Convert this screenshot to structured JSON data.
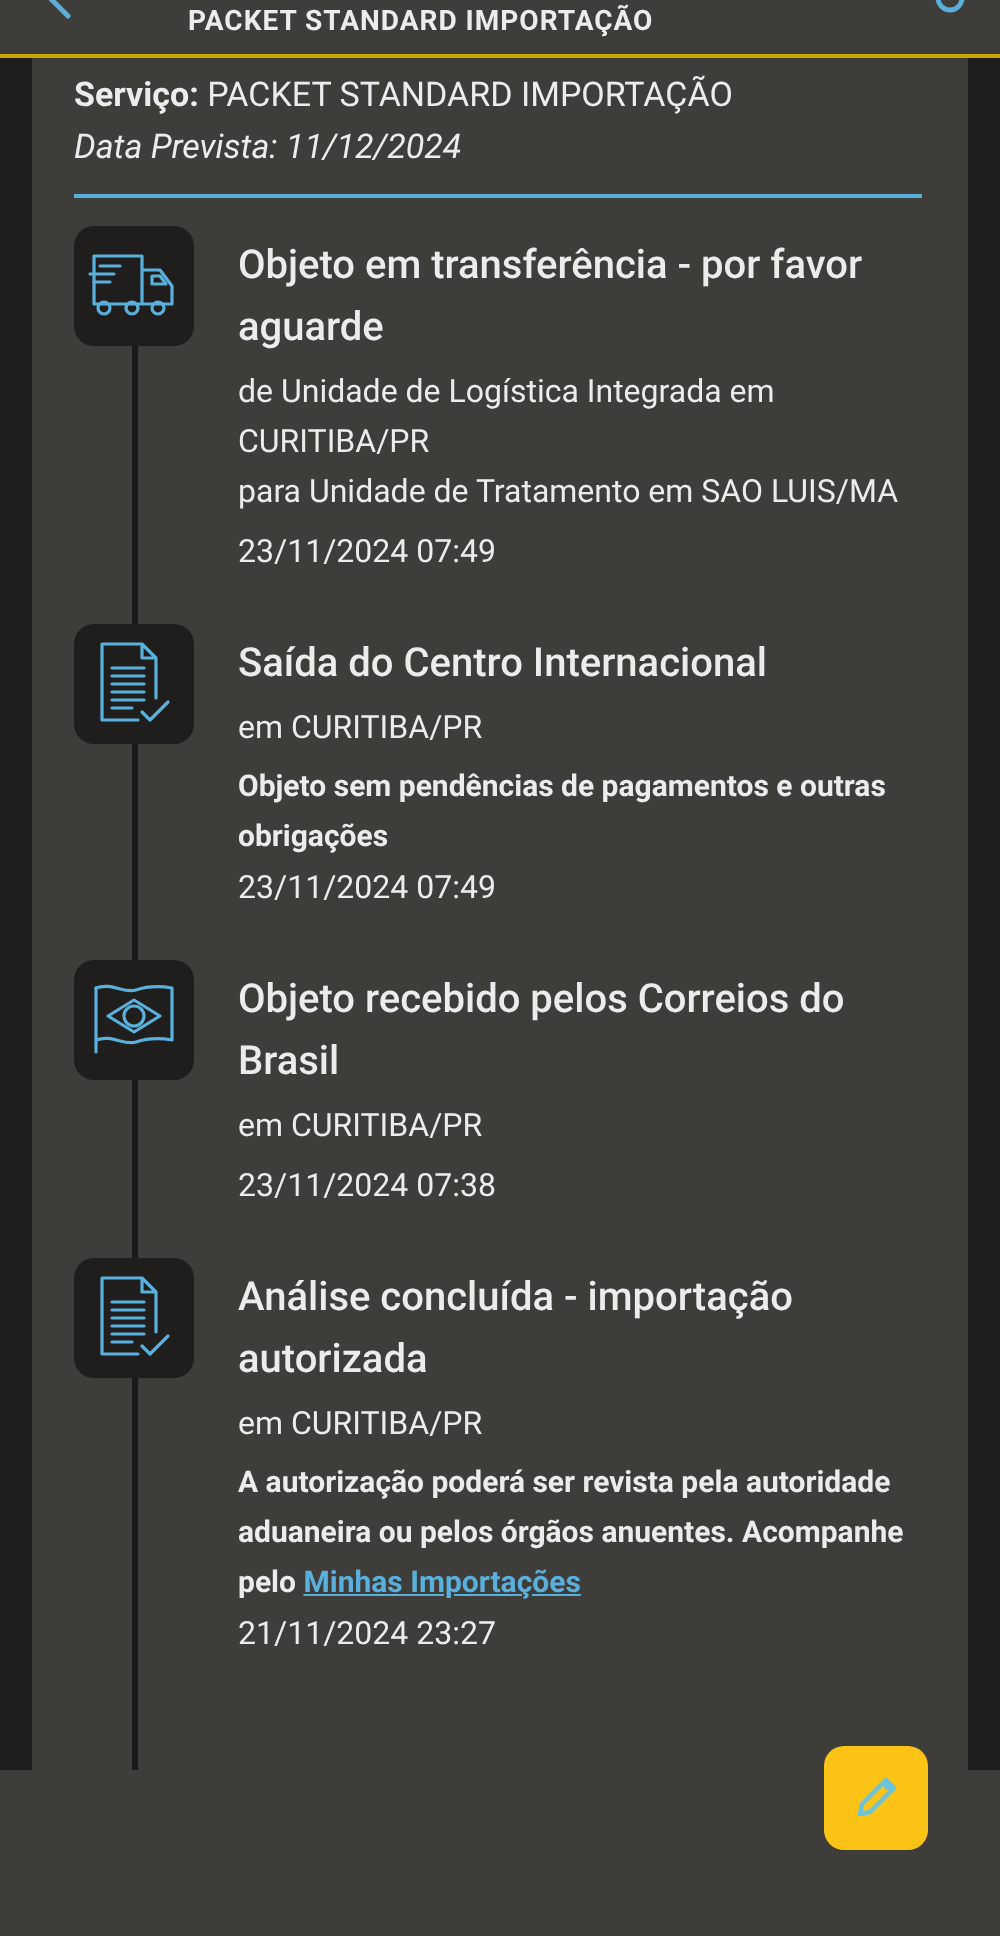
{
  "app_bar": {
    "title": "PACKET STANDARD IMPORTAÇÃO"
  },
  "summary": {
    "service_label": "Serviço:",
    "service": "PACKET STANDARD IMPORTAÇÃO",
    "due_date": "Data Prevista: 11/12/2024"
  },
  "events": [
    {
      "kind": "truck",
      "title": "Objeto em transferência - por favor aguarde",
      "lines": [
        "de Unidade de Logística Integrada em CURITIBA/PR",
        "para Unidade de Tratamento em SAO LUIS/MA"
      ],
      "date": "23/11/2024 07:49"
    },
    {
      "kind": "document",
      "title": "Saída do Centro Internacional",
      "lines": [
        "em CURITIBA/PR"
      ],
      "note": "Objeto sem pendências de pagamentos e outras obrigações",
      "date": "23/11/2024 07:49"
    },
    {
      "kind": "flag",
      "title": "Objeto recebido pelos Correios do Brasil",
      "lines": [
        "em CURITIBA/PR"
      ],
      "date": "23/11/2024 07:38"
    },
    {
      "kind": "document",
      "title": "Análise concluída - importação autorizada",
      "lines": [
        "em CURITIBA/PR"
      ],
      "note": "A autorização poderá ser revista pela autoridade aduaneira ou pelos órgãos anuentes. Acompanhe pelo",
      "link": "Minhas Importações",
      "date": "21/11/2024 23:27"
    }
  ]
}
